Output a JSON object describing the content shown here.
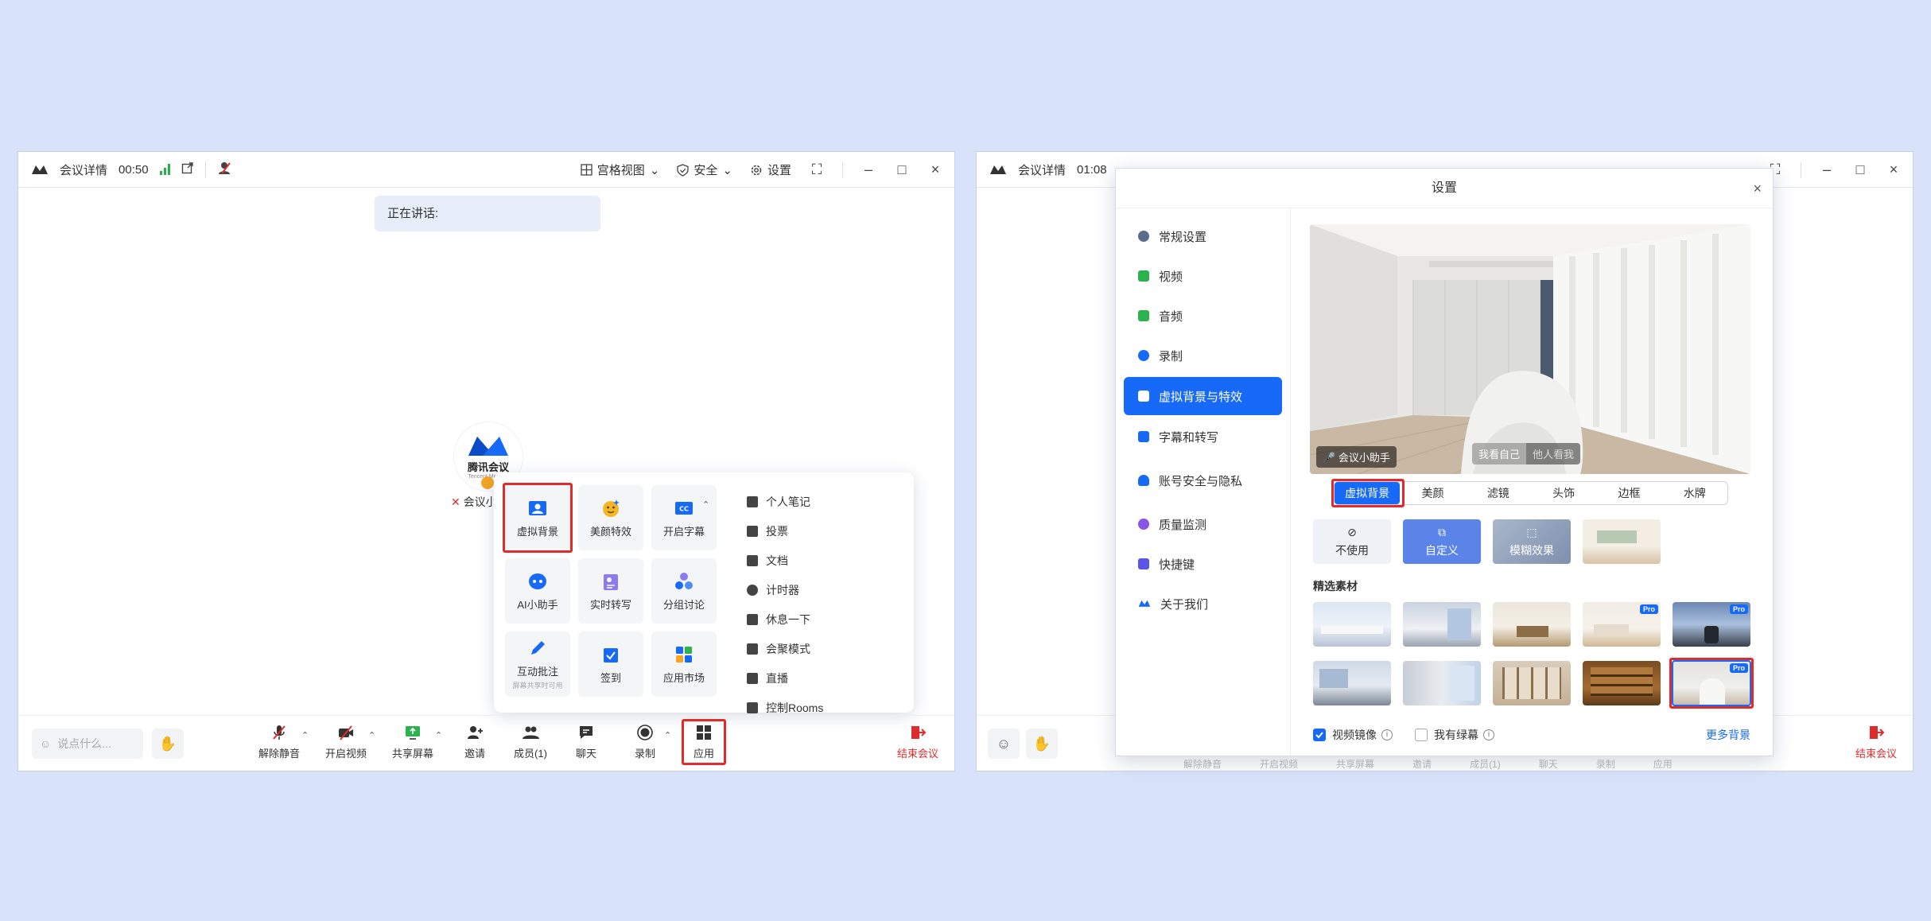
{
  "left_window": {
    "title": {
      "meeting_details": "会议详情",
      "timer": "00:50",
      "grid_view": "宫格视图",
      "security": "安全",
      "settings": "设置"
    },
    "speaking_label": "正在讲话:",
    "center_logo": {
      "brand": "腾讯会议",
      "sub": "Tencent Meeting"
    },
    "me_name": "会议小...",
    "apps_grid": [
      {
        "label": "虚拟背景",
        "icon": "virtual-background-icon"
      },
      {
        "label": "美颜特效",
        "icon": "beauty-icon"
      },
      {
        "label": "开启字幕",
        "icon": "caption-icon"
      },
      {
        "label": "AI小助手",
        "icon": "ai-assistant-icon"
      },
      {
        "label": "实时转写",
        "icon": "transcription-icon"
      },
      {
        "label": "分组讨论",
        "icon": "breakout-icon"
      },
      {
        "label": "互动批注",
        "icon": "annotation-icon",
        "hint": "屏幕共享时可用"
      },
      {
        "label": "签到",
        "icon": "checkin-icon"
      },
      {
        "label": "应用市场",
        "icon": "app-market-icon"
      }
    ],
    "apps_list": [
      {
        "label": "个人笔记"
      },
      {
        "label": "投票"
      },
      {
        "label": "文档"
      },
      {
        "label": "计时器"
      },
      {
        "label": "休息一下"
      },
      {
        "label": "会聚模式"
      },
      {
        "label": "直播"
      },
      {
        "label": "控制Rooms"
      }
    ],
    "toolbar": {
      "chat_placeholder": "说点什么...",
      "unmute": "解除静音",
      "start_video": "开启视频",
      "share_screen": "共享屏幕",
      "invite": "邀请",
      "members": "成员(1)",
      "chat": "聊天",
      "record": "录制",
      "apps": "应用",
      "end_meeting": "结束会议"
    }
  },
  "right_window": {
    "title": {
      "meeting_details": "会议详情",
      "timer": "01:08"
    },
    "ghost_labels": [
      "解除静音",
      "开启视频",
      "共享屏幕",
      "邀请",
      "成员(1)",
      "聊天",
      "录制",
      "应用"
    ],
    "end_meeting": "结束会议",
    "settings_modal": {
      "title": "设置",
      "nav": [
        {
          "label": "常规设置",
          "icon": "gear-icon",
          "color": "#5b6b8a"
        },
        {
          "label": "视频",
          "icon": "video-icon",
          "color": "#2bb24c"
        },
        {
          "label": "音频",
          "icon": "speaker-icon",
          "color": "#2bb24c"
        },
        {
          "label": "录制",
          "icon": "record-icon",
          "color": "#1769f7"
        },
        {
          "label": "虚拟背景与特效",
          "icon": "portrait-icon",
          "color": "#ffffff"
        },
        {
          "label": "字幕和转写",
          "icon": "subtitle-icon",
          "color": "#1769f7"
        },
        {
          "label": "账号安全与隐私",
          "icon": "account-icon",
          "color": "#1769f7"
        },
        {
          "label": "质量监测",
          "icon": "monitor-icon",
          "color": "#8a54e8"
        },
        {
          "label": "快捷键",
          "icon": "keyboard-icon",
          "color": "#5b54e8"
        },
        {
          "label": "关于我们",
          "icon": "logo-icon",
          "color": "#1769f7"
        }
      ],
      "preview": {
        "assistant_label": "会议小助手",
        "see_self": "我看自己",
        "others_see": "他人看我"
      },
      "subtabs": [
        "虚拟背景",
        "美颜",
        "滤镜",
        "头饰",
        "边框",
        "水牌"
      ],
      "options": {
        "none": "不使用",
        "custom": "自定义",
        "blur": "模糊效果"
      },
      "section_title": "精选素材",
      "pro_badge": "Pro",
      "footer": {
        "mirror": "视频镜像",
        "green_screen": "我有绿幕",
        "more": "更多背景"
      }
    }
  },
  "colors": {
    "accent": "#1769f7",
    "highlight_red": "#e02b2b",
    "page_bg": "#d8e3fb"
  }
}
